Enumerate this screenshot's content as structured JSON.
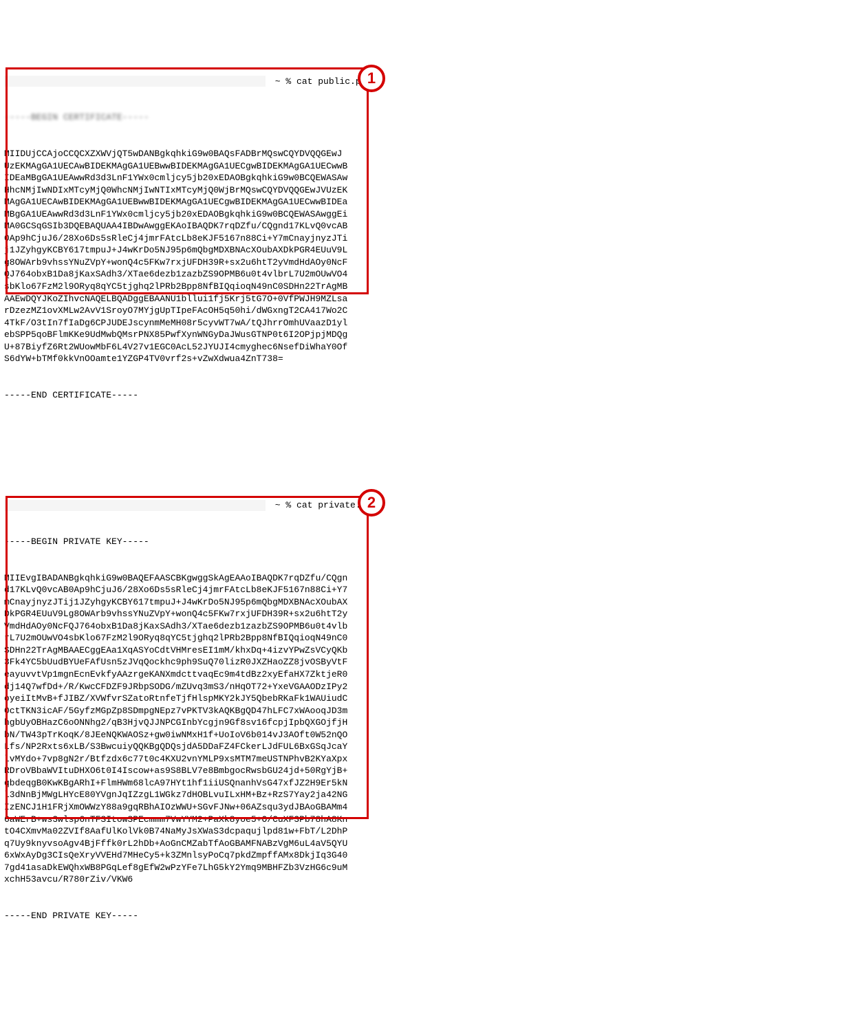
{
  "term": {
    "prompt_symbol": " ~ % ",
    "cmd1": "cat public.pem",
    "cmd2": "cat private.pem"
  },
  "public_cert": {
    "begin": "-----BEGIN CERTIFICATE-----",
    "end": "-----END CERTIFICATE-----",
    "lines": [
      "MIIDUjCCAjoCCQCXZXWVjQT5wDANBgkqhkiG9w0BAQsFADBrMQswCQYDVQQGEwJ",
      "UzEKMAgGA1UECAwBIDEKMAgGA1UEBwwBIDEKMAgGA1UECgwBIDEKMAgGA1UECwwB",
      "IDEaMBgGA1UEAwwRd3d3LnF1YWx0cmljcy5jb20xEDAOBgkqhkiG9w0BCQEWASAw",
      "HhcNMjIwNDIxMTcyMjQ0WhcNMjIwNTIxMTcyMjQ0WjBrMQswCQYDVQQGEwJVUzEK",
      "MAgGA1UECAwBIDEKMAgGA1UEBwwBIDEKMAgGA1UECgwBIDEKMAgGA1UECwwBIDEa",
      "MBgGA1UEAwwRd3d3LnF1YWx0cmljcy5jb20xEDAOBgkqhkiG9w0BCQEWASAwggEi",
      "MA0GCSqGSIb3DQEBAQUAA4IBDwAwggEKAoIBAQDK7rqDZfu/CQgnd17KLvQ0vcAB",
      "0Ap9hCjuJ6/28Xo6Ds5sRleCj4jmrFAtcLb8eKJF5167n88Ci+Y7mCnayjnyzJTi",
      "j1JZyhgyKCBY617tmpuJ+J4wKrDo5NJ95p6mQbgMDXBNAcXOubAXDkPGR4EUuV9L",
      "g8OWArb9vhssYNuZVpY+wonQ4c5FKw7rxjUFDH39R+sx2u6htT2yVmdHdAOy0NcF",
      "QJ764obxB1Da8jKaxSAdh3/XTae6dezb1zazbZS9OPMB6u0t4vlbrL7U2mOUwVO4",
      "sbKlo67FzM2l9ORyq8qYC5tjghq2lPRb2Bpp8NfBIQqioqN49nC0SDHn22TrAgMB",
      "AAEwDQYJKoZIhvcNAQELBQADggEBAANU1bllui1fj5Krj5tG7O+0VfPWJH9MZLsa",
      "rDzezMZ1ovXMLw2AvV1SroyO7MYjgUpTIpeFAcOH5q50hi/dWGxngT2CA417Wo2C",
      "4TkF/O3tIn7fIaDg6CPJUDEJscynmMeMH08r5cyvWT7wA/tQJhrrOmhUVaazD1yl",
      "ebSPP5qoBFlmKKe9UdMwbQMsrPNX85PwfXynWNGyDaJWusGTNP0t6I2OPjpjMDQg",
      "U+87BiyfZ6Rt2WUowMbF6L4V27v1EGC0AcL52JYUJI4cmyghec6NsefDiWhaY0Of",
      "S6dYW+bTMf0kkVnOOamte1YZGP4TV0vrf2s+vZwXdwua4ZnT738="
    ]
  },
  "private_key": {
    "begin": "-----BEGIN PRIVATE KEY-----",
    "end": "-----END PRIVATE KEY-----",
    "lines": [
      "MIIEvgIBADANBgkqhkiG9w0BAQEFAASCBKgwggSkAgEAAoIBAQDK7rqDZfu/CQgn",
      "d17KLvQ0vcAB0Ap9hCjuJ6/28Xo6Ds5sRleCj4jmrFAtcLb8eKJF5167n88Ci+Y7",
      "mCnayjnyzJTij1JZyhgyKCBY617tmpuJ+J4wKrDo5NJ95p6mQbgMDXBNAcXOubAX",
      "DkPGR4EUuV9Lg8OWArb9vhssYNuZVpY+wonQ4c5FKw7rxjUFDH39R+sx2u6htT2y",
      "VmdHdAOy0NcFQJ764obxB1Da8jKaxSAdh3/XTae6dezb1zazbZS9OPMB6u0t4vlb",
      "rL7U2mOUwVO4sbKlo67FzM2l9ORyq8qYC5tjghq2lPRb2Bpp8NfBIQqioqN49nC0",
      "SDHn22TrAgMBAAECggEAa1XqASYoCdtVHMresEI1mM/khxDq+4izvYPwZsVCyQKb",
      "3Fk4YC5bUudBYUeFAfUsn5zJVqQockhc9ph9SuQ70lizR0JXZHaoZZ8jvOSByVtF",
      "eayuvvtVp1mgnEcnEvkfyAAzrgeKANXmdcttvaqEc9m4tdBz2xyEfaHX7ZktjeR0",
      "dj14Q7wfDd+/R/KwcCFDZF9JRbpSODG/mZUvq3mS3/nHqOT72+YxeVGAAODzIPy2",
      "oyeiItMvB+fJIBZ/XVWfvrSZatoRtnfeTjfHlspMKY2kJY5QbebRKaFk1WAUiudC",
      "0ctTKN3icAF/5GyfzMGpZp8SDmpgNEpz7vPKTV3kAQKBgQD47hLFC7xWAooqJD3m",
      "hgbUyOBHazC6oONNhg2/qB3HjvQJJNPCGInbYcgjn9Gf8sv16fcpjIpbQXGOjfjH",
      "bN/TW43pTrKoqK/8JEeNQKWAOSz+gw0iwNMxH1f+UoIoV6b014vJ3AOft0W52nQO",
      "Lfs/NP2Rxts6xLB/S3BwcuiyQQKBgQDQsjdA5DDaFZ4FCkerLJdFUL6BxGSqJcaY",
      "lvMYdo+7vp8gN2r/Btfzdx6c77t0c4KXU2vnYMLP9xsMTM7meUSTNPhvB2KYaXpx",
      "RDroVBbaWVItuDHXO6t0I4Iscow+as9S8BLV7e8BmbgocRwsbGU24jd+50RgYjB+",
      "qbdeqgB0KwKBgARhI+FlmHWm68lcA97HYt1hf1iiUSQnanhVsG47xfJZ2H9Er5kN",
      "l3dNnBjMWgLHYcE80YVgnJqIZzgL1WGkz7dHOBLvuILxHM+Bz+RzS7Yay2ja42NG",
      "IzENCJ1H1FRjXmOWWzY88a9gqRBhAIOzWWU+SGvFJNw+06AZsqu3ydJBAoGBAMm4",
      "6aWErB+ws3wlsp6nTFSItowSPEcmmm7VwYYM2+PaXk8yoe5+O/CuXF3Pb78hA8Kn",
      "tO4CXmvMa02ZVIf8AafUlKolVk0B74NaMyJsXWaS3dcpaqujlpd81w+FbT/L2DhP",
      "q7Uy9knyvsoAgv4BjFffk0rL2hDb+AoGnCMZabTfAoGBAMFNABzVgM6uL4aV5QYU",
      "6xWxAyDg3CIsQeXryVVEHd7MHeCy5+k3ZMnlsyPoCq7pkdZmpffAMx8DkjIq3G40",
      "7gd41asaDkEWQhxWB8PGqLef8gEfW2wPzYFe7LhG5kY2Ymq9MBHFZb3VzHG6c9uM",
      "xchH53avcu/R780rZiv/VKW6"
    ]
  },
  "annotations": {
    "circle1": "1",
    "circle2": "2"
  }
}
